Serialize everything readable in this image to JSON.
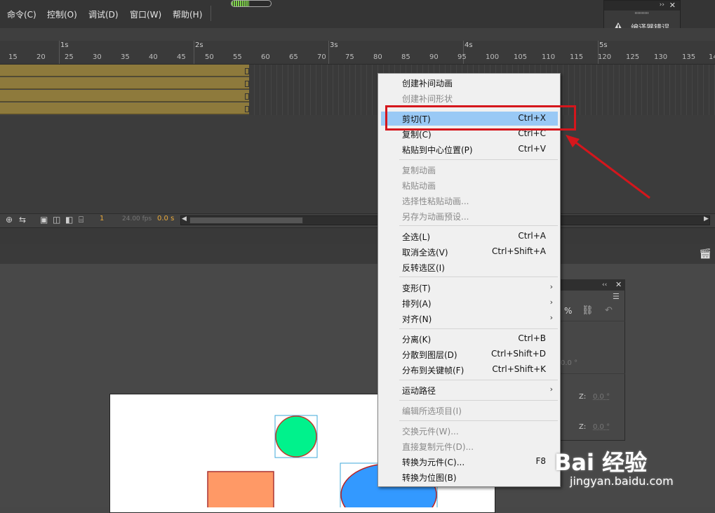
{
  "menubar": {
    "items": [
      "命令(C)",
      "控制(O)",
      "调试(D)",
      "窗口(W)",
      "帮助(H)"
    ]
  },
  "compiler_panel": {
    "collapse": "››",
    "close": "✕",
    "label": "编译器错误"
  },
  "timeline": {
    "seconds": [
      "1s",
      "2s",
      "3s",
      "4s",
      "5s"
    ],
    "frame_numbers": [
      "15",
      "20",
      "25",
      "30",
      "35",
      "40",
      "45",
      "50",
      "55",
      "60",
      "65",
      "70",
      "75",
      "80",
      "85",
      "90",
      "95",
      "100",
      "105",
      "110",
      "115",
      "120",
      "125",
      "130",
      "135",
      "14"
    ],
    "current_frame": "1",
    "fps": "24.00 fps",
    "time": "0.0 s"
  },
  "context_menu": {
    "items": [
      {
        "label": "创建补间动画",
        "shortcut": "",
        "disabled": false
      },
      {
        "label": "创建补间形状",
        "shortcut": "",
        "disabled": true
      },
      {
        "label": "剪切(T)",
        "shortcut": "Ctrl+X",
        "disabled": false,
        "highlighted": true
      },
      {
        "label": "复制(C)",
        "shortcut": "Ctrl+C",
        "disabled": false
      },
      {
        "label": "粘贴到中心位置(P)",
        "shortcut": "Ctrl+V",
        "disabled": false
      },
      {
        "label": "复制动画",
        "shortcut": "",
        "disabled": true
      },
      {
        "label": "粘贴动画",
        "shortcut": "",
        "disabled": true
      },
      {
        "label": "选择性粘贴动画...",
        "shortcut": "",
        "disabled": true
      },
      {
        "label": "另存为动画预设...",
        "shortcut": "",
        "disabled": true
      },
      {
        "label": "全选(L)",
        "shortcut": "Ctrl+A",
        "disabled": false
      },
      {
        "label": "取消全选(V)",
        "shortcut": "Ctrl+Shift+A",
        "disabled": false
      },
      {
        "label": "反转选区(I)",
        "shortcut": "",
        "disabled": false
      },
      {
        "label": "变形(T)",
        "shortcut": "",
        "disabled": false,
        "submenu": true
      },
      {
        "label": "排列(A)",
        "shortcut": "",
        "disabled": false,
        "submenu": true
      },
      {
        "label": "对齐(N)",
        "shortcut": "",
        "disabled": false,
        "submenu": true
      },
      {
        "label": "分离(K)",
        "shortcut": "Ctrl+B",
        "disabled": false
      },
      {
        "label": "分散到图层(D)",
        "shortcut": "Ctrl+Shift+D",
        "disabled": false
      },
      {
        "label": "分布到关键帧(F)",
        "shortcut": "Ctrl+Shift+K",
        "disabled": false
      },
      {
        "label": "运动路径",
        "shortcut": "",
        "disabled": false,
        "submenu": true
      },
      {
        "label": "编辑所选项目(I)",
        "shortcut": "",
        "disabled": true
      },
      {
        "label": "交换元件(W)...",
        "shortcut": "",
        "disabled": true
      },
      {
        "label": "直接复制元件(D)...",
        "shortcut": "",
        "disabled": true
      },
      {
        "label": "转换为元件(C)...",
        "shortcut": "F8",
        "disabled": false
      },
      {
        "label": "转换为位图(B)",
        "shortcut": "",
        "disabled": false
      }
    ]
  },
  "transform_panel": {
    "collapse": "‹‹",
    "close": "✕",
    "pct": "%",
    "value1": "0.0 °",
    "z_label": "Z:",
    "z_value": "0.0 °"
  },
  "watermark": {
    "brand": "Bai 经验",
    "url": "jingyan.baidu.com"
  },
  "colors": {
    "highlight": "#99c9f5",
    "annotation_red": "#d5161c",
    "green_circle": "#00f28c",
    "orange_rect": "#ff9966",
    "blue_ellipse": "#3399ff",
    "frame_fill": "#8e7a3c"
  },
  "icons": [
    "warning-icon",
    "clapper-icon",
    "chevron-right-icon",
    "close-icon",
    "link-icon",
    "reset-icon",
    "menu-icon"
  ]
}
